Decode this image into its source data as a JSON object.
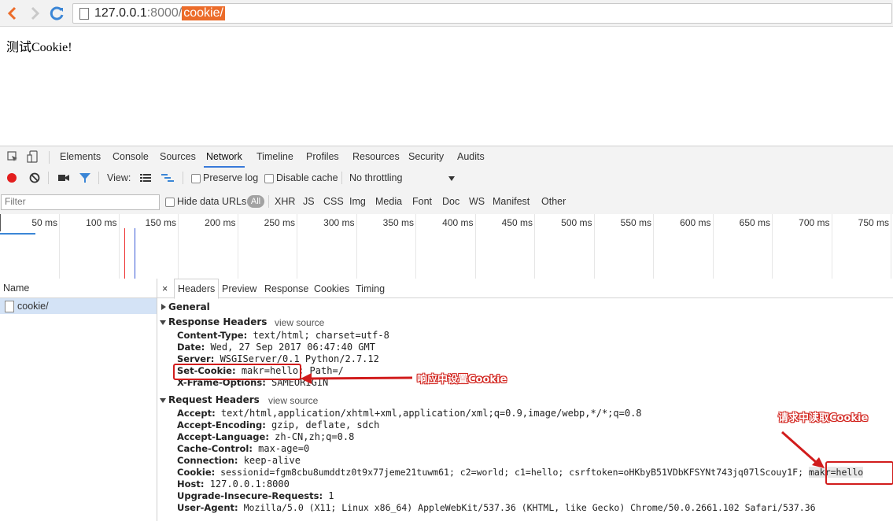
{
  "browser": {
    "url_host": "127.0.0.1",
    "url_port": ":8000/",
    "url_path": "cookie/"
  },
  "page": {
    "body_text": "测试Cookie!"
  },
  "devtools": {
    "tabs": [
      "Elements",
      "Console",
      "Sources",
      "Network",
      "Timeline",
      "Profiles",
      "Resources",
      "Security",
      "Audits"
    ],
    "active_tab": "Network",
    "toolbar": {
      "view_label": "View:",
      "preserve_log": "Preserve log",
      "disable_cache": "Disable cache",
      "throttling": "No throttling"
    },
    "filterbar": {
      "filter_placeholder": "Filter",
      "hide_data_urls": "Hide data URLs",
      "all": "All",
      "types": [
        "XHR",
        "JS",
        "CSS",
        "Img",
        "Media",
        "Font",
        "Doc",
        "WS",
        "Manifest",
        "Other"
      ]
    },
    "timeline_ticks": [
      "50 ms",
      "100 ms",
      "150 ms",
      "200 ms",
      "250 ms",
      "300 ms",
      "350 ms",
      "400 ms",
      "450 ms",
      "500 ms",
      "550 ms",
      "600 ms",
      "650 ms",
      "700 ms",
      "750 ms"
    ],
    "name_column": "Name",
    "requests": [
      {
        "name": "cookie/"
      }
    ],
    "detail_tabs": [
      "Headers",
      "Preview",
      "Response",
      "Cookies",
      "Timing"
    ],
    "close_symbol": "×",
    "general": "General",
    "response_headers": {
      "title": "Response Headers",
      "view_source": "view source",
      "rows": [
        {
          "k": "Content-Type:",
          "v": "text/html; charset=utf-8"
        },
        {
          "k": "Date:",
          "v": "Wed, 27 Sep 2017 06:47:40 GMT"
        },
        {
          "k": "Server:",
          "v": "WSGIServer/0.1 Python/2.7.12"
        },
        {
          "k": "Set-Cookie:",
          "v": "makr=hello;",
          "v2": "Path=/"
        },
        {
          "k": "X-Frame-Options:",
          "v": "SAMEORIGIN"
        }
      ]
    },
    "request_headers": {
      "title": "Request Headers",
      "view_source": "view source",
      "rows": [
        {
          "k": "Accept:",
          "v": "text/html,application/xhtml+xml,application/xml;q=0.9,image/webp,*/*;q=0.8"
        },
        {
          "k": "Accept-Encoding:",
          "v": "gzip, deflate, sdch"
        },
        {
          "k": "Accept-Language:",
          "v": "zh-CN,zh;q=0.8"
        },
        {
          "k": "Cache-Control:",
          "v": "max-age=0"
        },
        {
          "k": "Connection:",
          "v": "keep-alive"
        },
        {
          "k": "Cookie:",
          "v": "sessionid=fgm8cbu8umddtz0t9x77jeme21tuwm61; c2=world; c1=hello; csrftoken=oHKbyB51VDbKFSYNt743jq07lScouy1F;",
          "v2": "makr=hello"
        },
        {
          "k": "Host:",
          "v": "127.0.0.1:8000"
        },
        {
          "k": "Upgrade-Insecure-Requests:",
          "v": "1"
        },
        {
          "k": "User-Agent:",
          "v": "Mozilla/5.0 (X11; Linux x86_64) AppleWebKit/537.36 (KHTML, like Gecko) Chrome/50.0.2661.102 Safari/537.36"
        }
      ]
    }
  },
  "annotations": {
    "response_note": "响应中设置Cookie",
    "request_note": "请求中读取Cookie"
  }
}
